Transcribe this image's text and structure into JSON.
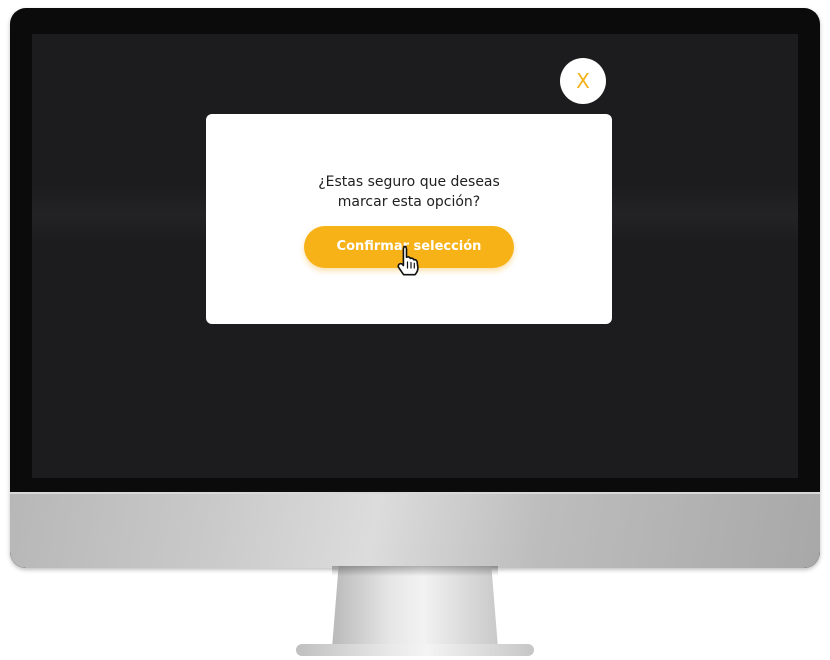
{
  "dialog": {
    "question_line1": "¿Estas seguro que deseas",
    "question_line2": "marcar esta opción?",
    "confirm_label": "Confirmar selección",
    "close_label": "X"
  },
  "colors": {
    "accent": "#f7b218",
    "screen": "#1c1c1e",
    "modal": "#ffffff"
  },
  "icons": {
    "cursor": "hand-pointer-icon",
    "close": "close-icon"
  }
}
